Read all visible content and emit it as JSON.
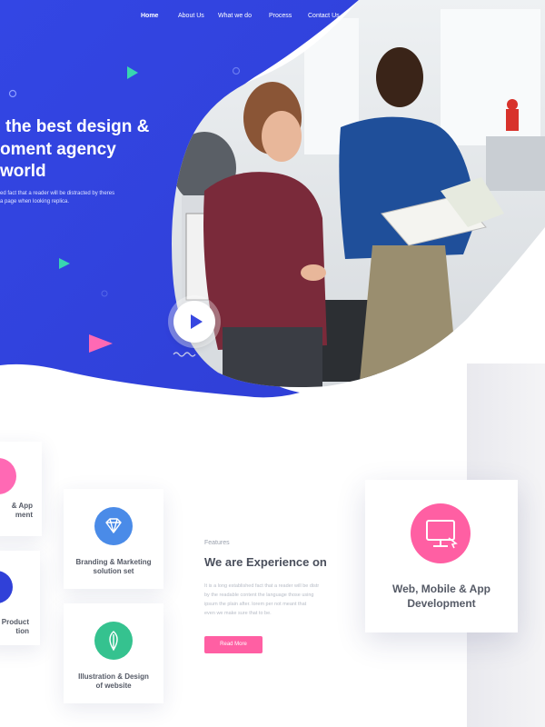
{
  "nav": {
    "items": [
      "Home",
      "About Us",
      "What we do",
      "Process",
      "Contact Us"
    ],
    "active": "Home"
  },
  "hero": {
    "title_lines": [
      "the best design &",
      "oment agency",
      "world"
    ],
    "subtitle_lines": [
      "ed fact that a reader will be distracted by theres",
      "a page when looking replica."
    ]
  },
  "services_left": [
    {
      "label_lines": [
        "& App",
        "ment"
      ],
      "icon": "pink-circle-icon",
      "color": "#ff69b4"
    },
    {
      "label_lines": [
        "Product",
        "tion"
      ],
      "icon": "blue-circle-icon",
      "color": "#3040d8"
    }
  ],
  "services_middle": [
    {
      "label_lines": [
        "Branding & Marketing",
        "solution set"
      ],
      "icon": "diamond-icon",
      "color": "#4a8be8"
    },
    {
      "label_lines": [
        "Illustration & Design",
        "of website"
      ],
      "icon": "leaf-icon",
      "color": "#35c28f"
    }
  ],
  "features": {
    "eyebrow": "Features",
    "title": "We are Experience on",
    "text_lines": [
      "It is a long established fact that a reader will be distr",
      "by the readable content the language those using",
      "ipsum the plain after. lorem per not meant that",
      "even we make sure that to be."
    ],
    "button": "Read More"
  },
  "highlight_card": {
    "label_lines": [
      "Web, Mobile & App",
      "Development"
    ],
    "icon": "monitor-icon",
    "color": "#ff5fa3"
  },
  "colors": {
    "hero_blue": "#3747e0",
    "accent_pink": "#ff5fa3",
    "accent_green": "#35c28f"
  }
}
